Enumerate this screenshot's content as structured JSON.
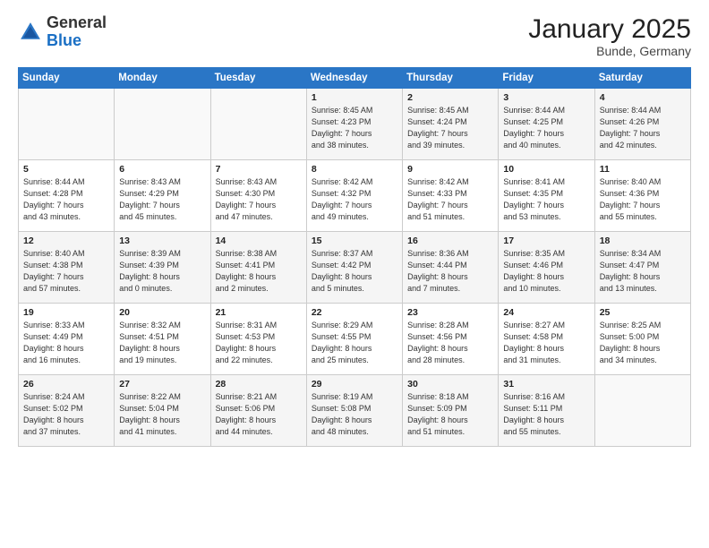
{
  "logo": {
    "general": "General",
    "blue": "Blue"
  },
  "header": {
    "title": "January 2025",
    "subtitle": "Bunde, Germany"
  },
  "weekdays": [
    "Sunday",
    "Monday",
    "Tuesday",
    "Wednesday",
    "Thursday",
    "Friday",
    "Saturday"
  ],
  "weeks": [
    [
      {
        "day": "",
        "info": ""
      },
      {
        "day": "",
        "info": ""
      },
      {
        "day": "",
        "info": ""
      },
      {
        "day": "1",
        "info": "Sunrise: 8:45 AM\nSunset: 4:23 PM\nDaylight: 7 hours\nand 38 minutes."
      },
      {
        "day": "2",
        "info": "Sunrise: 8:45 AM\nSunset: 4:24 PM\nDaylight: 7 hours\nand 39 minutes."
      },
      {
        "day": "3",
        "info": "Sunrise: 8:44 AM\nSunset: 4:25 PM\nDaylight: 7 hours\nand 40 minutes."
      },
      {
        "day": "4",
        "info": "Sunrise: 8:44 AM\nSunset: 4:26 PM\nDaylight: 7 hours\nand 42 minutes."
      }
    ],
    [
      {
        "day": "5",
        "info": "Sunrise: 8:44 AM\nSunset: 4:28 PM\nDaylight: 7 hours\nand 43 minutes."
      },
      {
        "day": "6",
        "info": "Sunrise: 8:43 AM\nSunset: 4:29 PM\nDaylight: 7 hours\nand 45 minutes."
      },
      {
        "day": "7",
        "info": "Sunrise: 8:43 AM\nSunset: 4:30 PM\nDaylight: 7 hours\nand 47 minutes."
      },
      {
        "day": "8",
        "info": "Sunrise: 8:42 AM\nSunset: 4:32 PM\nDaylight: 7 hours\nand 49 minutes."
      },
      {
        "day": "9",
        "info": "Sunrise: 8:42 AM\nSunset: 4:33 PM\nDaylight: 7 hours\nand 51 minutes."
      },
      {
        "day": "10",
        "info": "Sunrise: 8:41 AM\nSunset: 4:35 PM\nDaylight: 7 hours\nand 53 minutes."
      },
      {
        "day": "11",
        "info": "Sunrise: 8:40 AM\nSunset: 4:36 PM\nDaylight: 7 hours\nand 55 minutes."
      }
    ],
    [
      {
        "day": "12",
        "info": "Sunrise: 8:40 AM\nSunset: 4:38 PM\nDaylight: 7 hours\nand 57 minutes."
      },
      {
        "day": "13",
        "info": "Sunrise: 8:39 AM\nSunset: 4:39 PM\nDaylight: 8 hours\nand 0 minutes."
      },
      {
        "day": "14",
        "info": "Sunrise: 8:38 AM\nSunset: 4:41 PM\nDaylight: 8 hours\nand 2 minutes."
      },
      {
        "day": "15",
        "info": "Sunrise: 8:37 AM\nSunset: 4:42 PM\nDaylight: 8 hours\nand 5 minutes."
      },
      {
        "day": "16",
        "info": "Sunrise: 8:36 AM\nSunset: 4:44 PM\nDaylight: 8 hours\nand 7 minutes."
      },
      {
        "day": "17",
        "info": "Sunrise: 8:35 AM\nSunset: 4:46 PM\nDaylight: 8 hours\nand 10 minutes."
      },
      {
        "day": "18",
        "info": "Sunrise: 8:34 AM\nSunset: 4:47 PM\nDaylight: 8 hours\nand 13 minutes."
      }
    ],
    [
      {
        "day": "19",
        "info": "Sunrise: 8:33 AM\nSunset: 4:49 PM\nDaylight: 8 hours\nand 16 minutes."
      },
      {
        "day": "20",
        "info": "Sunrise: 8:32 AM\nSunset: 4:51 PM\nDaylight: 8 hours\nand 19 minutes."
      },
      {
        "day": "21",
        "info": "Sunrise: 8:31 AM\nSunset: 4:53 PM\nDaylight: 8 hours\nand 22 minutes."
      },
      {
        "day": "22",
        "info": "Sunrise: 8:29 AM\nSunset: 4:55 PM\nDaylight: 8 hours\nand 25 minutes."
      },
      {
        "day": "23",
        "info": "Sunrise: 8:28 AM\nSunset: 4:56 PM\nDaylight: 8 hours\nand 28 minutes."
      },
      {
        "day": "24",
        "info": "Sunrise: 8:27 AM\nSunset: 4:58 PM\nDaylight: 8 hours\nand 31 minutes."
      },
      {
        "day": "25",
        "info": "Sunrise: 8:25 AM\nSunset: 5:00 PM\nDaylight: 8 hours\nand 34 minutes."
      }
    ],
    [
      {
        "day": "26",
        "info": "Sunrise: 8:24 AM\nSunset: 5:02 PM\nDaylight: 8 hours\nand 37 minutes."
      },
      {
        "day": "27",
        "info": "Sunrise: 8:22 AM\nSunset: 5:04 PM\nDaylight: 8 hours\nand 41 minutes."
      },
      {
        "day": "28",
        "info": "Sunrise: 8:21 AM\nSunset: 5:06 PM\nDaylight: 8 hours\nand 44 minutes."
      },
      {
        "day": "29",
        "info": "Sunrise: 8:19 AM\nSunset: 5:08 PM\nDaylight: 8 hours\nand 48 minutes."
      },
      {
        "day": "30",
        "info": "Sunrise: 8:18 AM\nSunset: 5:09 PM\nDaylight: 8 hours\nand 51 minutes."
      },
      {
        "day": "31",
        "info": "Sunrise: 8:16 AM\nSunset: 5:11 PM\nDaylight: 8 hours\nand 55 minutes."
      },
      {
        "day": "",
        "info": ""
      }
    ]
  ]
}
